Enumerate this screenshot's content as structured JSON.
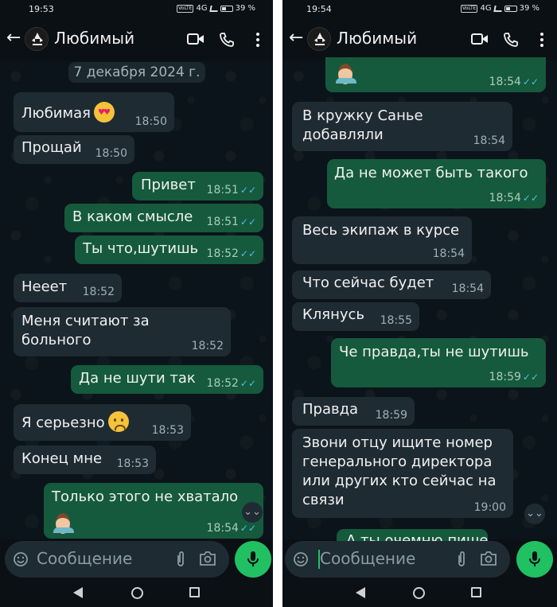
{
  "left": {
    "status": {
      "time": "19:53",
      "volte": "VoLTE",
      "net": "4G",
      "battery": "39 %"
    },
    "header": {
      "contact_name": "Любимый"
    },
    "date_separator": "7 декабря 2024 г.",
    "messages": [
      {
        "dir": "in",
        "text": "Любимая",
        "emoji": "heart-eyes-emoji",
        "time": "18:50"
      },
      {
        "dir": "in",
        "text": "Прощай",
        "time": "18:50"
      },
      {
        "dir": "out",
        "text": "Привет",
        "time": "18:51",
        "read": true
      },
      {
        "dir": "out",
        "text": "В каком смысле",
        "time": "18:51",
        "read": true
      },
      {
        "dir": "out",
        "text": "Ты что,шутишь",
        "time": "18:52",
        "read": true
      },
      {
        "dir": "in",
        "text": "Нееет",
        "time": "18:52"
      },
      {
        "dir": "in",
        "text": "Меня считают за больного",
        "time": "18:52"
      },
      {
        "dir": "out",
        "text": "Да не шути так",
        "time": "18:52",
        "read": true
      },
      {
        "dir": "in",
        "text": "Я серьезно",
        "emoji": "worried-face-emoji",
        "time": "18:53"
      },
      {
        "dir": "in",
        "text": "Конец мне",
        "time": "18:53"
      },
      {
        "dir": "out",
        "text": "Только этого не хватало",
        "emoji": "facepalm-emoji",
        "time": "18:54",
        "read": true
      }
    ],
    "input": {
      "placeholder": "Сообщение"
    }
  },
  "right": {
    "status": {
      "time": "19:54",
      "volte": "VoLTE",
      "net": "4G",
      "battery": "39 %"
    },
    "header": {
      "contact_name": "Любимый"
    },
    "messages": [
      {
        "dir": "out",
        "emoji": "facepalm-emoji",
        "time": "18:54",
        "read": true
      },
      {
        "dir": "in",
        "text": "В кружку Санье добавляли",
        "time": "18:54"
      },
      {
        "dir": "out",
        "text": "Да не может быть такого",
        "time": "18:54",
        "read": true
      },
      {
        "dir": "in",
        "text": "Весь экипаж в курсе",
        "time": "18:54"
      },
      {
        "dir": "in",
        "text": "Что сейчас будет",
        "time": "18:54"
      },
      {
        "dir": "in",
        "text": "Клянусь",
        "time": "18:55"
      },
      {
        "dir": "out",
        "text": "Че правда,ты не шутишь",
        "time": "18:59",
        "read": true
      },
      {
        "dir": "in",
        "text": "Правда",
        "time": "18:59"
      },
      {
        "dir": "in",
        "text": "Звони отцу ищите номер генерального директора или других кто сейчас на связи",
        "time": "19:00"
      }
    ],
    "partial_message": "А ты очемню пишет",
    "input": {
      "placeholder": "Сообщение"
    }
  },
  "icons": {
    "read_ticks": "✓✓",
    "back_arrow": "←",
    "scroll_down": "⌄⌄"
  },
  "colors": {
    "incoming_bubble": "#1f2b33",
    "outgoing_bubble": "#155a3c",
    "accent_green": "#21c063",
    "read_tick": "#53bdeb"
  }
}
